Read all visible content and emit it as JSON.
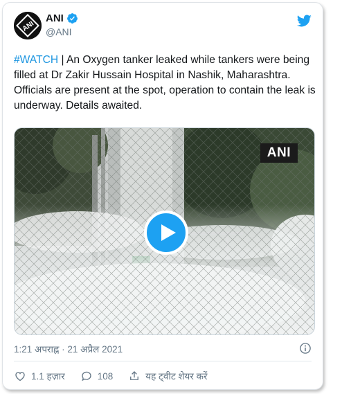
{
  "author": {
    "name": "ANI",
    "handle": "@ANI",
    "avatar_text": "ANI"
  },
  "tweet": {
    "hashtag": "#WATCH",
    "text": " | An Oxygen tanker leaked while tankers were being filled at Dr Zakir Hussain Hospital in Nashik, Maharashtra. Officials are present at the spot, operation to contain the leak is underway. Details awaited."
  },
  "media": {
    "watermark": "ANI"
  },
  "timestamp": "1:21 अपराह्न · 21 अप्रैल 2021",
  "actions": {
    "likes": "1.1 हज़ार",
    "replies": "108",
    "share_label": "यह ट्वीट शेयर करें"
  },
  "icons": {
    "verified": "verified-badge-icon",
    "bird": "twitter-bird-icon",
    "info": "info-icon",
    "like": "heart-icon",
    "reply": "reply-icon",
    "share": "share-icon",
    "play": "play-icon"
  },
  "colors": {
    "accent": "#1da1f2",
    "hashtag": "#1b95e0",
    "secondary_text": "#657786"
  }
}
